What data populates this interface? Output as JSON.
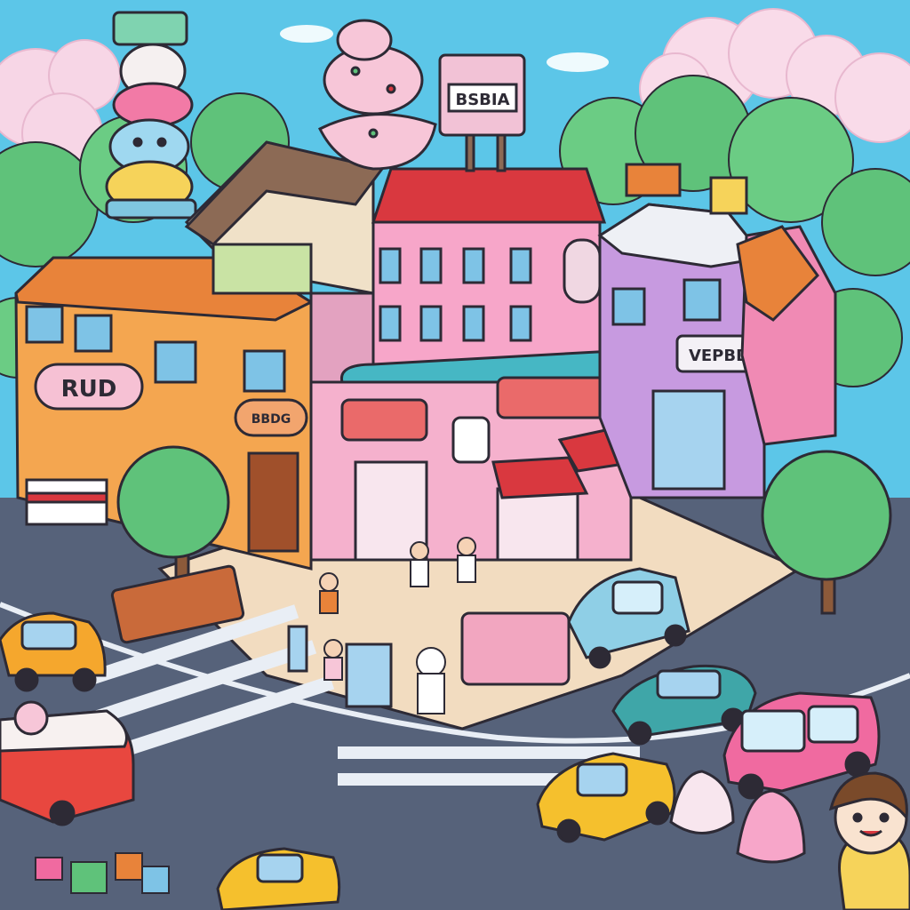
{
  "scene": {
    "title": "",
    "signs": {
      "rooftop_billboard": "BSBIA",
      "left_shop_sign": "RUD",
      "small_round_sign": "BBDG",
      "right_shop_sign": "VEPBD"
    },
    "colors": {
      "sky": "#5cc6e8",
      "cloud": "#f7d6e6",
      "tree": "#5fc27a",
      "tree_dark": "#3e9a5c",
      "road": "#56627a",
      "sidewalk": "#f2dcc0",
      "pink_building": "#f7a6c9",
      "orange_building": "#f4a650",
      "purple_building": "#c79ae0",
      "teal_awning": "#46b7c4",
      "red_roof": "#d9383f",
      "brown_roof": "#8c6a55",
      "yellow_car": "#f5b32d",
      "pink_car": "#f06aa0",
      "teal_car": "#3fa6a8",
      "outline": "#2d2a35"
    }
  }
}
